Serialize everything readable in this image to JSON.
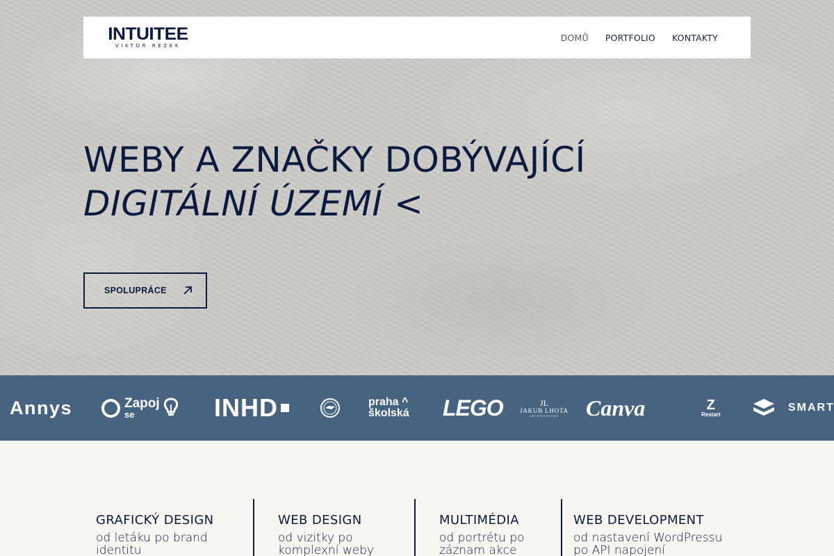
{
  "brand": {
    "logo_main": "INTUITEE",
    "logo_sub": "VIKTOR REZEK"
  },
  "nav": {
    "items": [
      {
        "label": "DOMŮ",
        "active": true
      },
      {
        "label": "PORTFOLIO",
        "active": false
      },
      {
        "label": "KONTAKTY",
        "active": false
      }
    ]
  },
  "hero": {
    "line1": "WEBY A ZNAČKY DOBÝVAJÍCÍ",
    "line2": "DIGITÁLNÍ ÚZEMÍ <",
    "cta_label": "SPOLUPRÁCE",
    "cta_icon": "arrow-up-right-icon"
  },
  "clients": {
    "annys": "Annys",
    "zapoj_1": "Zapoj",
    "zapoj_2": "se",
    "inhd": "INHD",
    "praha_1": "praha",
    "praha_2": "školská",
    "lego": "LEGO",
    "jakub_1": "JL",
    "jakub_2": "JAKUB LHOTA",
    "jakub_3": "ARCHITEKTURA",
    "canva": "Canva",
    "restart_1": "Z",
    "restart_2": "Restart",
    "smart": "SMART"
  },
  "services": [
    {
      "title": "GRAFICKÝ DESIGN",
      "desc_1": "od letáku po brand",
      "desc_2": "identitu"
    },
    {
      "title": "WEB DESIGN",
      "desc_1": "od vizitky po",
      "desc_2": "komplexní weby"
    },
    {
      "title": "MULTIMÉDIA",
      "desc_1": "od portrétu po",
      "desc_2": "záznam akce"
    },
    {
      "title": "WEB DEVELOPMENT",
      "desc_1": "od nastavení WordPressu",
      "desc_2": "po API napojení"
    }
  ],
  "colors": {
    "navy": "#0b1a3f",
    "strip": "#476380",
    "hero_bg": "#cbcac6",
    "page_bg": "#f7f6f1"
  }
}
